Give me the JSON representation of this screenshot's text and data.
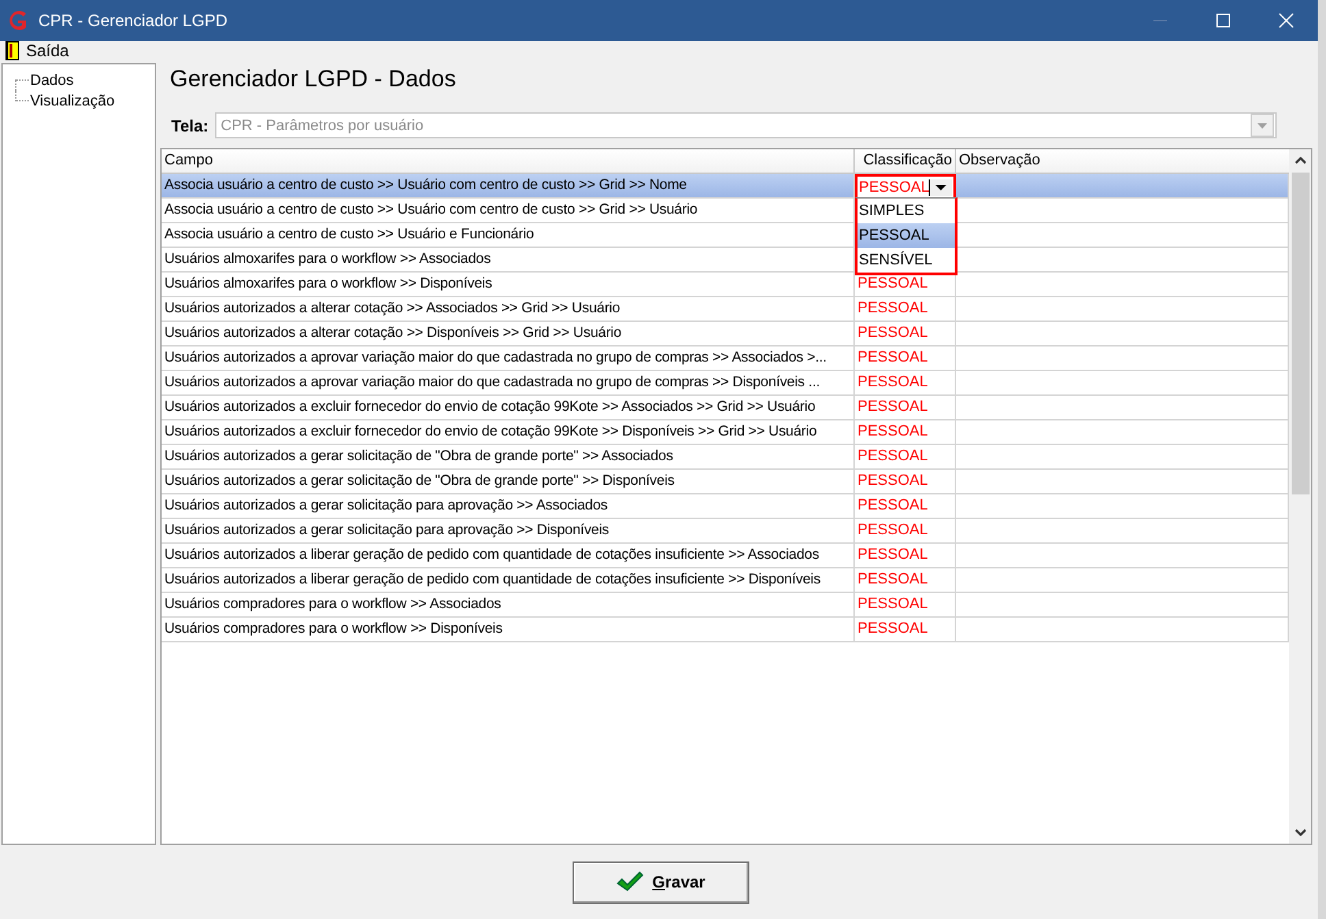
{
  "window": {
    "title": "CPR - Gerenciador LGPD"
  },
  "menu": [
    {
      "label": "Saída"
    }
  ],
  "tree": [
    {
      "label": "Dados"
    },
    {
      "label": "Visualização"
    }
  ],
  "heading": "Gerenciador LGPD - Dados",
  "tela": {
    "label": "Tela:",
    "value": "CPR - Parâmetros por usuário",
    "disabled": true
  },
  "table": {
    "columns": [
      "Campo",
      "Classificação",
      "Observação"
    ],
    "rows": [
      {
        "campo": "Associa usuário a centro de custo >> Usuário com centro de custo >> Grid >> Nome",
        "selected": true
      },
      {
        "campo": "Associa usuário a centro de custo >> Usuário com centro de custo >> Grid >> Usuário",
        "selected": false
      },
      {
        "campo": "Associa usuário a centro de custo >> Usuário e Funcionário",
        "selected": false
      },
      {
        "campo": "Usuários almoxarifes para o workflow >> Associados",
        "selected": false
      },
      {
        "campo": "Usuários almoxarifes para o workflow >> Disponíveis",
        "classificacao": "PESSOAL",
        "selected": false
      },
      {
        "campo": "Usuários autorizados a alterar cotação >> Associados >> Grid >> Usuário",
        "classificacao": "PESSOAL",
        "selected": false
      },
      {
        "campo": "Usuários autorizados a alterar cotação >> Disponíveis >> Grid >> Usuário",
        "classificacao": "PESSOAL",
        "selected": false
      },
      {
        "campo": "Usuários autorizados a aprovar variação maior do que cadastrada no grupo de compras >> Associados >...",
        "classificacao": "PESSOAL",
        "selected": false
      },
      {
        "campo": "Usuários autorizados a aprovar variação maior do que cadastrada no grupo de compras >> Disponíveis ...",
        "classificacao": "PESSOAL",
        "selected": false
      },
      {
        "campo": "Usuários autorizados a excluir fornecedor do envio de cotação 99Kote >> Associados >> Grid >> Usuário",
        "classificacao": "PESSOAL",
        "selected": false
      },
      {
        "campo": "Usuários autorizados a excluir fornecedor do envio de cotação 99Kote >> Disponíveis >> Grid >> Usuário",
        "classificacao": "PESSOAL",
        "selected": false
      },
      {
        "campo": "Usuários autorizados a gerar solicitação de \"Obra de grande porte\" >> Associados",
        "classificacao": "PESSOAL",
        "selected": false
      },
      {
        "campo": "Usuários autorizados a gerar solicitação de \"Obra de grande porte\" >> Disponíveis",
        "classificacao": "PESSOAL",
        "selected": false
      },
      {
        "campo": "Usuários autorizados a gerar solicitação para aprovação >> Associados",
        "classificacao": "PESSOAL",
        "selected": false
      },
      {
        "campo": "Usuários autorizados a gerar solicitação para aprovação >> Disponíveis",
        "classificacao": "PESSOAL",
        "selected": false
      },
      {
        "campo": "Usuários autorizados a liberar geração de pedido com quantidade de cotações insuficiente >> Associados",
        "classificacao": "PESSOAL",
        "selected": false
      },
      {
        "campo": "Usuários autorizados a liberar geração de pedido com quantidade de cotações insuficiente >> Disponíveis",
        "classificacao": "PESSOAL",
        "selected": false
      },
      {
        "campo": "Usuários compradores para o workflow >> Associados",
        "classificacao": "PESSOAL",
        "selected": false
      },
      {
        "campo": "Usuários compradores para o workflow >> Disponíveis",
        "classificacao": "PESSOAL",
        "selected": false
      }
    ],
    "editor": {
      "value": "PESSOAL",
      "expanded": true,
      "options": [
        {
          "label": "SIMPLES",
          "selected": false
        },
        {
          "label": "PESSOAL",
          "selected": true
        },
        {
          "label": "SENSÍVEL",
          "selected": false
        }
      ]
    }
  },
  "buttons": [
    {
      "label": "Gravar"
    }
  ]
}
